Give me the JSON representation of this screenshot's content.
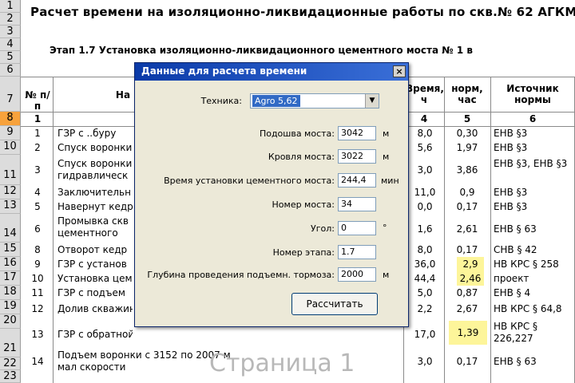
{
  "sheet": {
    "title": "Расчет времени на изоляционно-ликвидационные работы по скв.№ 62  АГКМ",
    "subtitle": "Этап 1.7  Установка изоляционно-ликвидационного цементного моста № 1 в",
    "row_numbers": [
      "1",
      "2",
      "3",
      "4",
      "5",
      "6",
      "7",
      "8",
      "9",
      "10",
      "11",
      "12",
      "13",
      "14",
      "15",
      "16",
      "17",
      "18",
      "19",
      "20",
      "21",
      "22",
      "23"
    ],
    "header": {
      "col_no": "№ п/п",
      "col_name": "На",
      "col_time": "Время, ч",
      "col_norm_h": "норм, час",
      "col_source": "Источник нормы",
      "idx_no": "1",
      "idx_4": "4",
      "idx_5": "5",
      "idx_6": "6"
    },
    "rows": [
      {
        "no": "1",
        "name": "ГЗР с ..буру",
        "time": "8,0",
        "norm": "0,30",
        "src": "ЕНВ §3"
      },
      {
        "no": "2",
        "name": "Спуск воронки",
        "time": "5,6",
        "norm": "1,97",
        "src": "ЕНВ §3"
      },
      {
        "no": "3",
        "name": "Спуск воронки гидравлическ",
        "time": "3,0",
        "norm": "3,86",
        "src": "ЕНВ §3, ЕНВ §3"
      },
      {
        "no": "4",
        "name": "Заключительн",
        "time": "11,0",
        "norm": "0,9",
        "src": "ЕНВ §3"
      },
      {
        "no": "5",
        "name": "Навернут кедр",
        "time": "0,0",
        "norm": "0,17",
        "src": "ЕНВ §3"
      },
      {
        "no": "6",
        "name": "Промывка скв цементного мо",
        "time": "1,6",
        "norm": "2,61",
        "src": "ЕНВ § 63"
      },
      {
        "no": "8",
        "name": "Отворот кедр",
        "time": "8,0",
        "norm": "0,17",
        "src": "СНВ § 42"
      },
      {
        "no": "9",
        "name": "ГЗР с установ",
        "time": "36,0",
        "norm": "2,9",
        "src": "НВ КРС § 258"
      },
      {
        "no": "10",
        "name": "Установка цем",
        "time": "44,4",
        "norm": "2,46",
        "src": "проект"
      },
      {
        "no": "11",
        "name": "ГЗР с подъем",
        "time": "5,0",
        "norm": "0,87",
        "src": "ЕНВ § 4"
      },
      {
        "no": "12",
        "name": "Долив скважин",
        "time": "2,2",
        "norm": "2,67",
        "src": "НВ КРС § 64,8"
      },
      {
        "no": "13",
        "name": "ГЗР с обратной промывкой",
        "time": "17,0",
        "norm": "1,39",
        "src": "НВ КРС § 226,227"
      },
      {
        "no": "14",
        "name": "Подъем воронки с 3152 по 2007 м мал скорости",
        "time": "3,0",
        "norm": "0,17",
        "src": "ЕНВ § 63"
      }
    ],
    "watermark": "Страница 1"
  },
  "dialog": {
    "title": "Данные для расчета времени",
    "close_label": "×",
    "technique_label": "Техника:",
    "technique_value": "Agro 5,62",
    "fields": [
      {
        "label": "Подошва моста:",
        "value": "3042",
        "unit": "м"
      },
      {
        "label": "Кровля моста:",
        "value": "3022",
        "unit": "м"
      },
      {
        "label": "Время установки цементного моста:",
        "value": "244,4",
        "unit": "мин"
      },
      {
        "label": "Номер моста:",
        "value": "34",
        "unit": ""
      },
      {
        "label": "Угол:",
        "value": "0",
        "unit": "°"
      },
      {
        "label": "Номер этапа:",
        "value": "1.7",
        "unit": ""
      },
      {
        "label": "Глубина проведения подъемн. тормоза:",
        "value": "2000",
        "unit": "м"
      }
    ],
    "calc_label": "Рассчитать"
  },
  "colors": {
    "selected_row": "#f7a23c",
    "highlight": "#fdf59a",
    "title_bar": "#0a3aa8",
    "dialog_bg": "#ece9d8"
  }
}
